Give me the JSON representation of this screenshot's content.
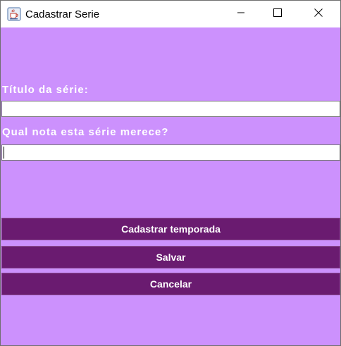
{
  "window": {
    "title": "Cadastrar Serie",
    "icons": {
      "app": "java-coffee-cup-icon",
      "minimize": "minimize-icon",
      "maximize": "maximize-icon",
      "close": "close-icon"
    }
  },
  "form": {
    "title_label": "Título da série:",
    "title_value": "",
    "rating_label": "Qual nota esta série merece?",
    "rating_value": ""
  },
  "actions": {
    "add_season_label": "Cadastrar temporada",
    "save_label": "Salvar",
    "cancel_label": "Cancelar"
  },
  "colors": {
    "background": "#cc91fd",
    "button": "#6a1b70",
    "text_light": "#ffffff"
  }
}
